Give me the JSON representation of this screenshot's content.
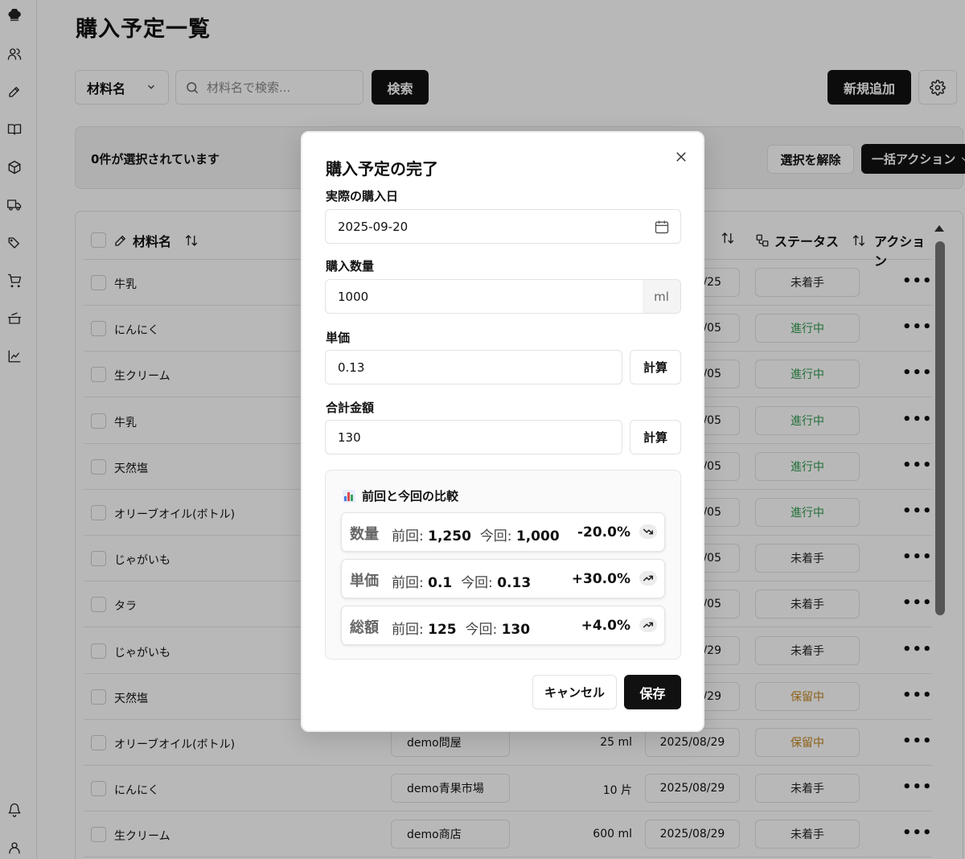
{
  "sidebar": {
    "top_icons": [
      "chef-hat-icon",
      "users-icon",
      "pen-icon",
      "book-icon",
      "box-icon",
      "truck-icon",
      "tags-icon",
      "cart-icon",
      "pot-icon",
      "chart-line-icon"
    ],
    "bottom_icons": [
      "bell-icon",
      "user-icon"
    ]
  },
  "page": {
    "title": "購入予定一覧",
    "filter_label": "材料名",
    "search_placeholder": "材料名で検索...",
    "search_button": "検索",
    "new_button": "新規追加"
  },
  "selection": {
    "text": "0件が選択されています",
    "clear_button": "選択を解除",
    "bulk_button": "一括アクション"
  },
  "table": {
    "headers": {
      "name": "材料名",
      "status": "ステータス",
      "action": "アクション"
    },
    "rows": [
      {
        "name": "牛乳",
        "supplier": "",
        "qty": "",
        "date": "/25",
        "status": "未着手",
        "status_type": "todo"
      },
      {
        "name": "にんにく",
        "supplier": "",
        "qty": "",
        "date": "/05",
        "status": "進行中",
        "status_type": "progress"
      },
      {
        "name": "生クリーム",
        "supplier": "",
        "qty": "",
        "date": "/05",
        "status": "進行中",
        "status_type": "progress"
      },
      {
        "name": "牛乳",
        "supplier": "",
        "qty": "",
        "date": "/05",
        "status": "進行中",
        "status_type": "progress"
      },
      {
        "name": "天然塩",
        "supplier": "",
        "qty": "",
        "date": "/05",
        "status": "進行中",
        "status_type": "progress"
      },
      {
        "name": "オリーブオイル(ボトル)",
        "supplier": "",
        "qty": "",
        "date": "/05",
        "status": "進行中",
        "status_type": "progress"
      },
      {
        "name": "じゃがいも",
        "supplier": "",
        "qty": "",
        "date": "/05",
        "status": "未着手",
        "status_type": "todo"
      },
      {
        "name": "タラ",
        "supplier": "",
        "qty": "",
        "date": "/05",
        "status": "未着手",
        "status_type": "todo"
      },
      {
        "name": "じゃがいも",
        "supplier": "",
        "qty": "",
        "date": "/29",
        "status": "未着手",
        "status_type": "todo"
      },
      {
        "name": "天然塩",
        "supplier": "",
        "qty": "",
        "date": "/29",
        "status": "保留中",
        "status_type": "hold"
      },
      {
        "name": "オリーブオイル(ボトル)",
        "supplier": "demo問屋",
        "qty": "25 ml",
        "date": "2025/08/29",
        "status": "保留中",
        "status_type": "hold"
      },
      {
        "name": "にんにく",
        "supplier": "demo青果市場",
        "qty": "10 片",
        "date": "2025/08/29",
        "status": "未着手",
        "status_type": "todo"
      },
      {
        "name": "生クリーム",
        "supplier": "demo商店",
        "qty": "600 ml",
        "date": "2025/08/29",
        "status": "未着手",
        "status_type": "todo"
      }
    ]
  },
  "modal": {
    "title": "購入予定の完了",
    "date_label": "実際の購入日",
    "date_value": "2025-09-20",
    "qty_label": "購入数量",
    "qty_value": "1000",
    "qty_unit": "ml",
    "unit_price_label": "単価",
    "unit_price_value": "0.13",
    "total_label": "合計金額",
    "total_value": "130",
    "calc_button": "計算",
    "compare_title": "前回と今回の比較",
    "compare": [
      {
        "key": "数量",
        "prev_label": "前回:",
        "prev": "1,250",
        "curr_label": "今回:",
        "curr": "1,000",
        "pct": "-20.0%",
        "trend": "trend-down-icon"
      },
      {
        "key": "単価",
        "prev_label": "前回:",
        "prev": "0.1",
        "curr_label": "今回:",
        "curr": "0.13",
        "pct": "+30.0%",
        "trend": "trend-up-icon"
      },
      {
        "key": "総額",
        "prev_label": "前回:",
        "prev": "125",
        "curr_label": "今回:",
        "curr": "130",
        "pct": "+4.0%",
        "trend": "trend-up-icon"
      }
    ],
    "cancel_button": "キャンセル",
    "save_button": "保存"
  },
  "colors": {
    "status_progress": "#2e9a4d",
    "status_hold": "#c4871f",
    "primary": "#111111"
  }
}
